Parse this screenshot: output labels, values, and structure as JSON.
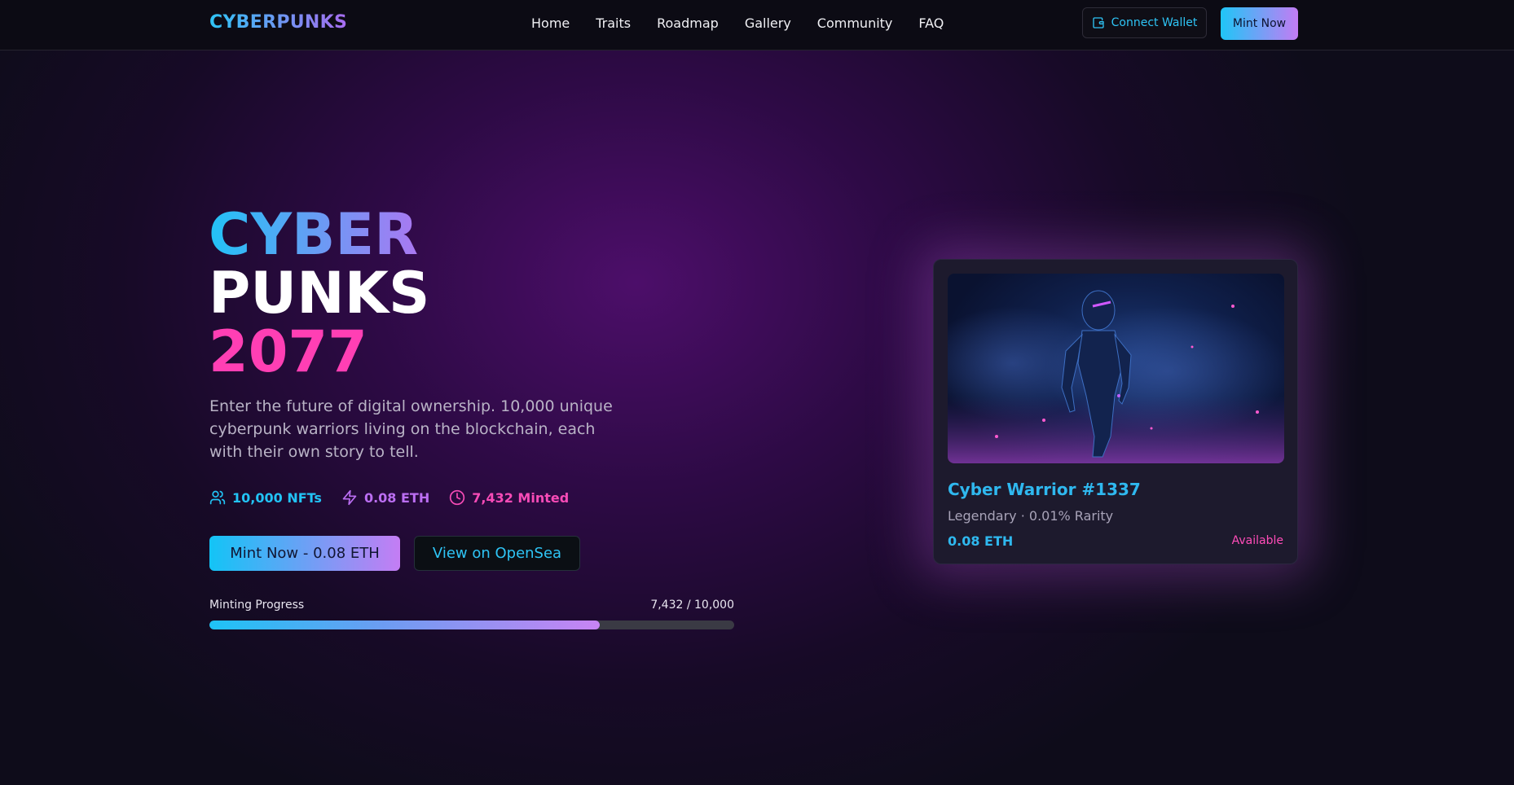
{
  "nav": {
    "logo": "CYBERPUNKS",
    "links": [
      "Home",
      "Traits",
      "Roadmap",
      "Gallery",
      "Community",
      "FAQ"
    ],
    "connect_wallet": "Connect Wallet",
    "mint_now": "Mint Now"
  },
  "hero": {
    "title_line1": "CYBER",
    "title_line2": "PUNKS",
    "title_line3": "2077",
    "description": "Enter the future of digital ownership. 10,000 unique cyberpunk warriors living on the blockchain, each with their own story to tell.",
    "stats": [
      {
        "icon": "users-icon",
        "text": "10,000 NFTs"
      },
      {
        "icon": "lightning-icon",
        "text": "0.08 ETH"
      },
      {
        "icon": "clock-icon",
        "text": "7,432 Minted"
      }
    ],
    "mint_button": "Mint Now - 0.08 ETH",
    "opensea_button": "View on OpenSea",
    "progress": {
      "label": "Minting Progress",
      "count": "7,432 / 10,000",
      "fraction": 0.7432
    }
  },
  "card": {
    "image_alt": "cyber-warrior-illustration",
    "title": "Cyber Warrior #1337",
    "subtitle": "Legendary · 0.01% Rarity",
    "price": "0.08 ETH",
    "status": "Available"
  },
  "colors": {
    "cyan": "#22c3f5",
    "purple": "#bb6ef2",
    "pink": "#f84bb7",
    "background": "#0f0d1c"
  }
}
